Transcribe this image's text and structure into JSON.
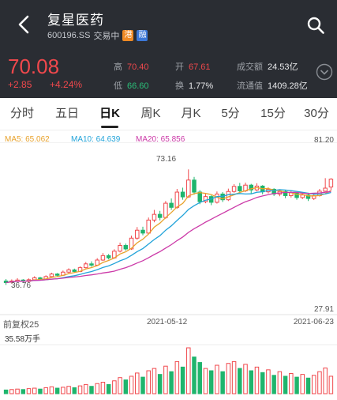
{
  "header": {
    "title": "复星医药",
    "code": "600196.SS",
    "status": "交易中",
    "tag_hk": "港",
    "tag_margin": "融"
  },
  "quote": {
    "price": "70.08",
    "change": "+2.85",
    "change_pct": "+4.24%",
    "high_label": "高",
    "high": "70.40",
    "low_label": "低",
    "low": "66.60",
    "open_label": "开",
    "open": "67.61",
    "turnover_label": "换",
    "turnover": "1.77%",
    "amount_label": "成交额",
    "amount": "24.53亿",
    "float_label": "流通值",
    "float": "1409.28亿"
  },
  "tabs": [
    "分时",
    "五日",
    "日K",
    "周K",
    "月K",
    "5分",
    "15分",
    "30分"
  ],
  "active_tab": "日K",
  "colors": {
    "up": "#f0484c",
    "down": "#1fb56d",
    "ma5": "#e8a22c",
    "ma10": "#21a3d9",
    "ma20": "#cc3aa8",
    "header": "#2a2d33"
  },
  "chart_data": {
    "type": "candlestick",
    "legend": {
      "ma5": "MA5: 65.062",
      "ma10": "MA10: 64.639",
      "ma20": "MA20: 65.856"
    },
    "y_max_label": "81.20",
    "y_min_label": "27.91",
    "peak_label": "73.16",
    "low_mark_label": "36.76",
    "x_labels": {
      "left": "前复权25",
      "mid": "2021-05-12",
      "right": "2021-06-23"
    },
    "volume_label": "35.58万手",
    "ylim": [
      27.91,
      81.2
    ],
    "candles": [
      [
        38.0,
        37.5,
        38.6,
        36.76
      ],
      [
        37.6,
        38.0,
        38.5,
        37.2
      ],
      [
        38.0,
        38.3,
        38.9,
        37.7
      ],
      [
        38.3,
        37.9,
        38.6,
        37.4
      ],
      [
        37.9,
        38.4,
        38.8,
        37.6
      ],
      [
        38.4,
        39.0,
        39.5,
        38.1
      ],
      [
        39.0,
        38.6,
        39.3,
        38.2
      ],
      [
        38.6,
        39.4,
        39.8,
        38.4
      ],
      [
        39.4,
        40.2,
        40.6,
        39.1
      ],
      [
        40.2,
        39.8,
        40.5,
        39.3
      ],
      [
        39.8,
        40.8,
        41.3,
        39.6
      ],
      [
        40.8,
        41.5,
        42.0,
        40.5
      ],
      [
        41.5,
        41.0,
        41.9,
        40.6
      ],
      [
        41.0,
        42.2,
        42.6,
        40.8
      ],
      [
        42.2,
        43.4,
        44.0,
        42.0
      ],
      [
        43.4,
        43.0,
        44.2,
        42.5
      ],
      [
        43.0,
        44.6,
        45.2,
        42.8
      ],
      [
        44.6,
        46.0,
        46.8,
        44.3
      ],
      [
        46.0,
        45.3,
        46.5,
        44.8
      ],
      [
        45.3,
        47.4,
        48.0,
        45.0
      ],
      [
        47.4,
        49.2,
        50.1,
        47.0
      ],
      [
        49.2,
        48.1,
        49.8,
        47.6
      ],
      [
        48.1,
        51.5,
        52.3,
        47.8
      ],
      [
        51.5,
        54.0,
        55.0,
        51.0
      ],
      [
        54.0,
        53.1,
        55.1,
        52.4
      ],
      [
        53.1,
        57.2,
        58.0,
        52.8
      ],
      [
        57.2,
        59.0,
        60.4,
        56.5
      ],
      [
        59.0,
        58.0,
        60.1,
        57.1
      ],
      [
        58.0,
        62.5,
        63.2,
        57.6
      ],
      [
        62.5,
        61.2,
        64.0,
        60.4
      ],
      [
        61.2,
        66.0,
        67.0,
        60.8
      ],
      [
        66.0,
        64.5,
        67.4,
        63.6
      ],
      [
        64.5,
        69.8,
        73.16,
        64.2
      ],
      [
        69.8,
        66.0,
        70.8,
        65.2
      ],
      [
        66.0,
        63.0,
        66.6,
        62.2
      ],
      [
        63.0,
        64.6,
        65.4,
        62.5
      ],
      [
        64.6,
        62.8,
        65.0,
        61.9
      ],
      [
        62.8,
        65.4,
        66.2,
        62.4
      ],
      [
        65.4,
        63.6,
        66.0,
        62.9
      ],
      [
        63.6,
        66.2,
        67.1,
        63.2
      ],
      [
        66.2,
        67.8,
        68.5,
        65.8
      ],
      [
        67.8,
        66.4,
        68.9,
        65.9
      ],
      [
        66.4,
        68.2,
        69.0,
        66.0
      ],
      [
        68.2,
        66.7,
        68.6,
        65.5
      ],
      [
        66.7,
        67.9,
        68.8,
        66.3
      ],
      [
        67.9,
        66.1,
        68.2,
        65.3
      ],
      [
        66.1,
        66.9,
        67.5,
        65.6
      ],
      [
        66.9,
        65.4,
        67.2,
        64.8
      ],
      [
        65.4,
        66.2,
        66.9,
        64.7
      ],
      [
        66.2,
        64.9,
        66.6,
        64.1
      ],
      [
        64.9,
        65.8,
        66.5,
        64.3
      ],
      [
        65.8,
        64.3,
        66.0,
        63.6
      ],
      [
        64.3,
        65.1,
        65.7,
        63.8
      ],
      [
        65.1,
        64.0,
        65.4,
        63.2
      ],
      [
        64.0,
        64.9,
        65.5,
        63.5
      ],
      [
        64.9,
        66.3,
        67.0,
        64.6
      ],
      [
        66.3,
        67.25,
        70.4,
        66.6
      ],
      [
        67.61,
        70.08,
        70.4,
        66.6
      ]
    ],
    "volumes": [
      8,
      9,
      10,
      9,
      11,
      12,
      10,
      13,
      15,
      12,
      14,
      16,
      13,
      17,
      20,
      16,
      22,
      25,
      20,
      28,
      35,
      30,
      38,
      45,
      36,
      50,
      55,
      42,
      60,
      48,
      70,
      58,
      100,
      80,
      68,
      55,
      50,
      62,
      48,
      66,
      70,
      55,
      64,
      50,
      58,
      46,
      52,
      40,
      48,
      38,
      44,
      36,
      42,
      34,
      40,
      48,
      56,
      38
    ]
  }
}
